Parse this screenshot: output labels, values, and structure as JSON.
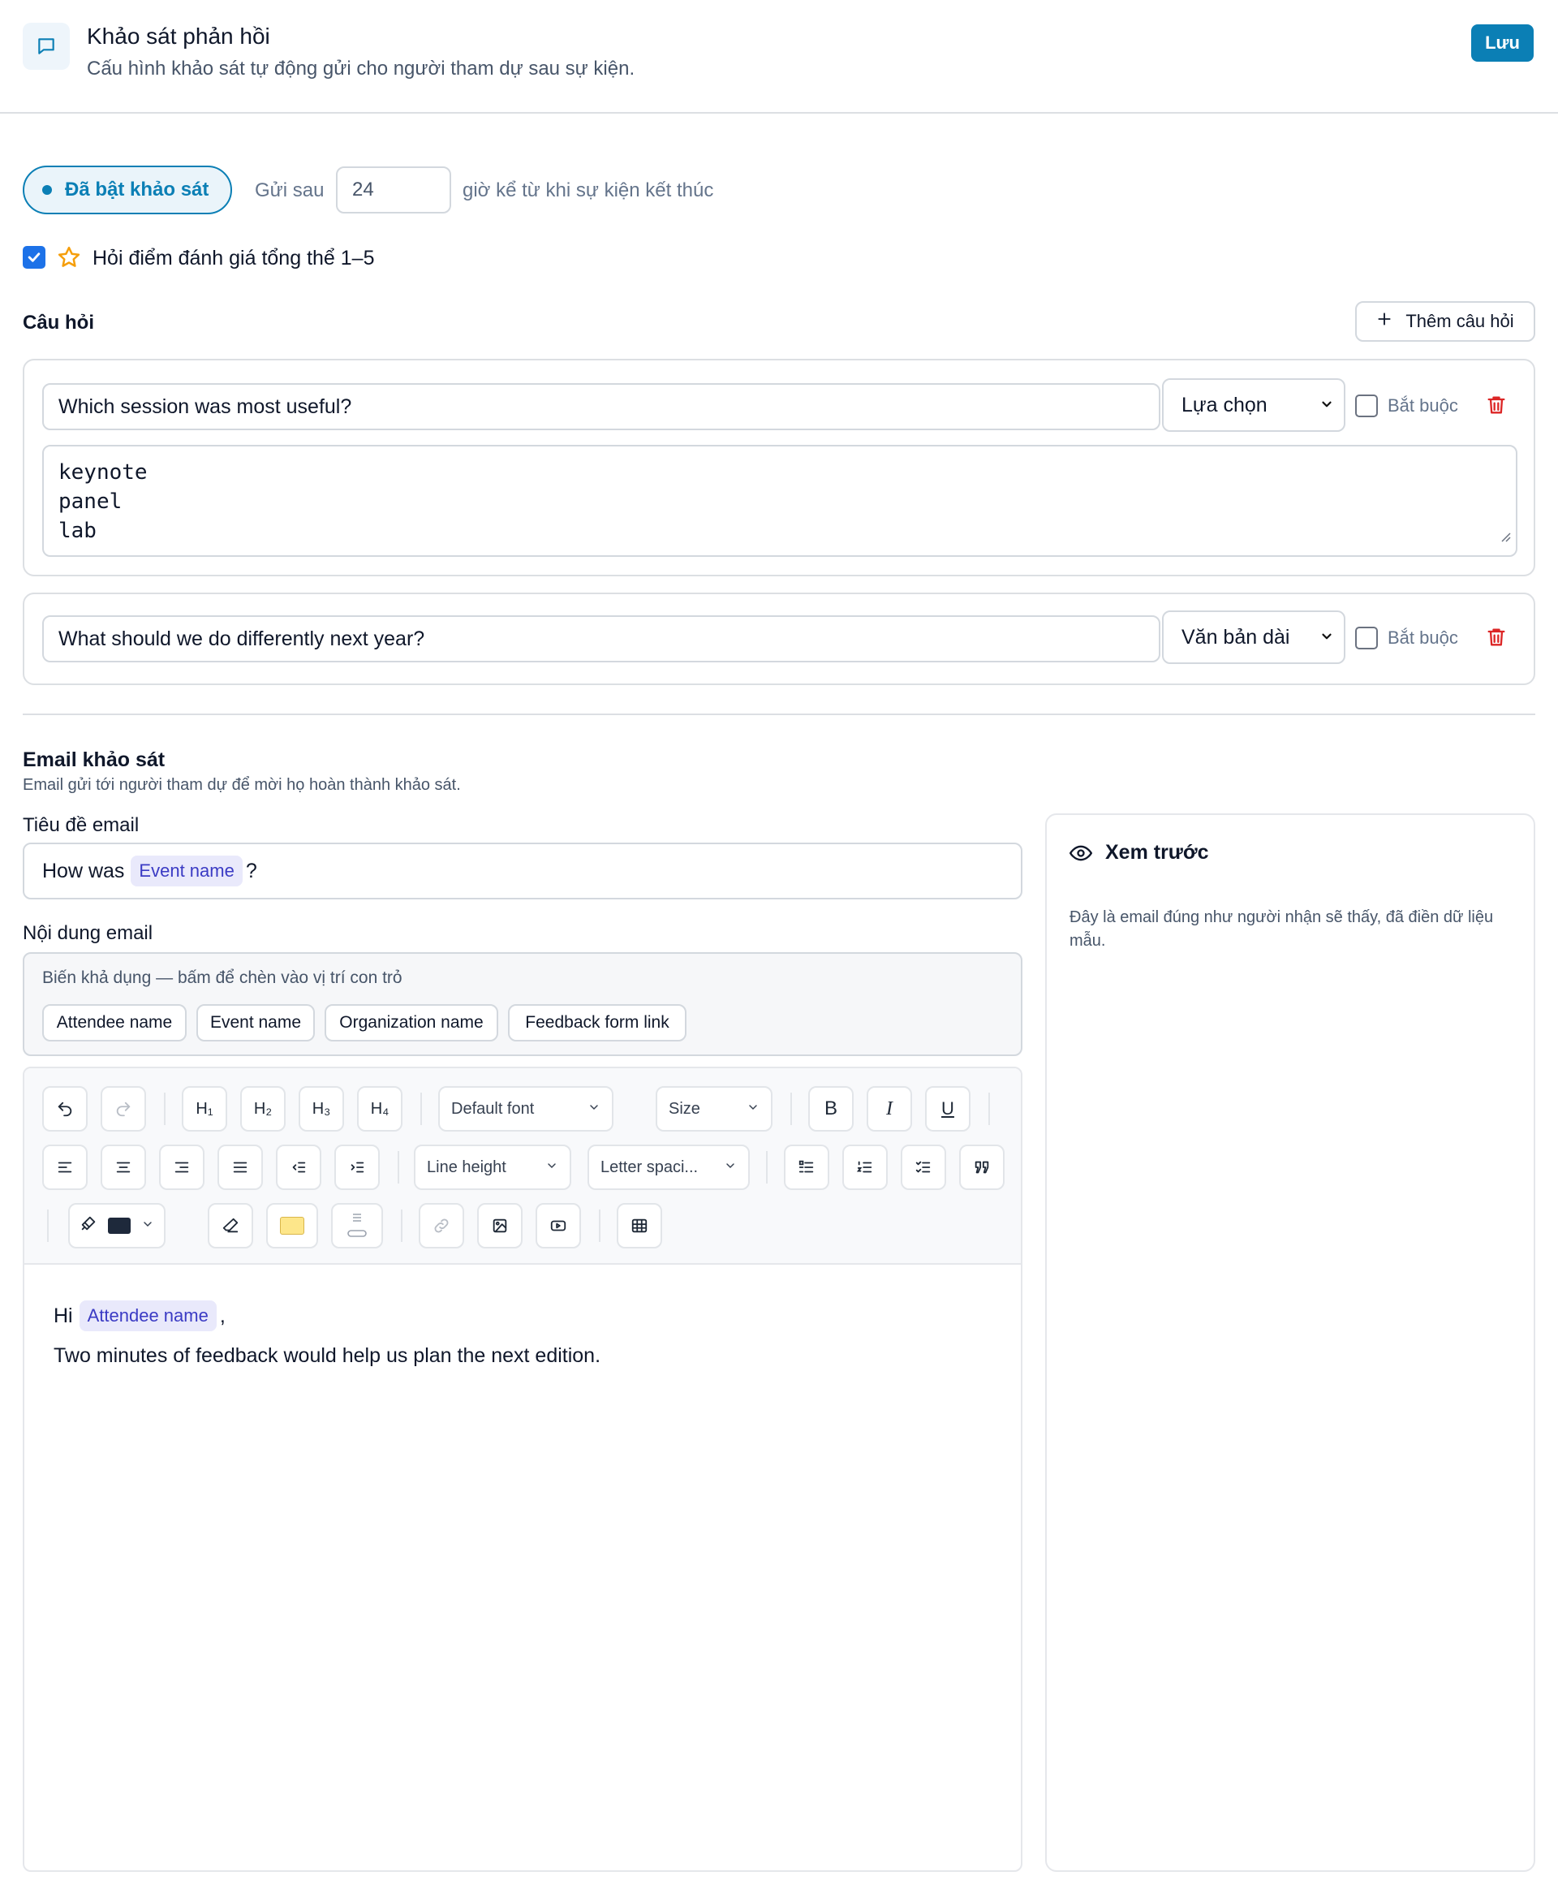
{
  "header": {
    "title": "Khảo sát phản hồi",
    "subtitle": "Cấu hình khảo sát tự động gửi cho người tham dự sau sự kiện.",
    "save_label": "Lưu",
    "icon": "chat-bubble-icon"
  },
  "survey": {
    "enabled_label": "Đã bật khảo sát",
    "send_after_label": "Gửi sau",
    "hours_value": "24",
    "hours_suffix": "giờ kể từ khi sự kiện kết thúc",
    "rating_checked": true,
    "rating_label": "Hỏi điểm đánh giá tổng thể 1–5"
  },
  "questions": {
    "heading": "Câu hỏi",
    "add_label": "Thêm câu hỏi",
    "items": [
      {
        "text": "Which session was most useful?",
        "type": "Lựa chọn",
        "required_label": "Bắt buộc",
        "options": [
          "keynote",
          "panel",
          "lab"
        ]
      },
      {
        "text": "What should we do differently next year?",
        "type": "Văn bản dài",
        "required_label": "Bắt buộc"
      }
    ]
  },
  "email": {
    "heading": "Email khảo sát",
    "subheading": "Email gửi tới người tham dự để mời họ hoàn thành khảo sát.",
    "subject_label": "Tiêu đề email",
    "subject_prefix": "How was",
    "subject_var": "Event name",
    "subject_suffix": "?",
    "body_label": "Nội dung email",
    "vars_title": "Biến khả dụng — bấm để chèn vào vị trí con trỏ",
    "vars": [
      "Attendee name",
      "Event name",
      "Organization name",
      "Feedback form link"
    ],
    "toolbar": {
      "h1": "H₁",
      "h2": "H₂",
      "h3": "H₃",
      "h4": "H₄",
      "font": "Default font",
      "size": "Size",
      "bold": "B",
      "italic": "I",
      "underline": "U",
      "line_height": "Line height",
      "letter_spacing": "Letter spaci...",
      "text_color": "#1e293b",
      "highlight_color": "#fde68a"
    },
    "body": {
      "greeting": "Hi",
      "greeting_var": "Attendee name",
      "greeting_suffix": ",",
      "line": "Two minutes of feedback would help us plan the next edition."
    }
  },
  "preview": {
    "title": "Xem trước",
    "description": "Đây là email đúng như người nhận sẽ thấy, đã điền dữ liệu mẫu."
  },
  "colors": {
    "accent": "#0b7fb5",
    "danger": "#dc2626",
    "star": "#f59e0b",
    "checkbox": "#1d72e8",
    "variable_chip_bg": "#e9e9fb",
    "variable_chip_text": "#3b3bc4"
  }
}
